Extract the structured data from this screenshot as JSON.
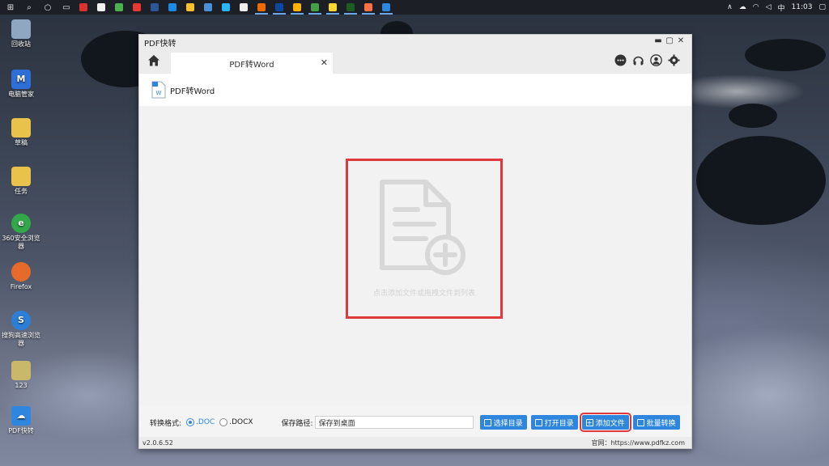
{
  "taskbar": {
    "clock": "11:03",
    "ime": "中",
    "tray_expand": "∧"
  },
  "desktop_icons": [
    {
      "label": "回收站",
      "color": "#8fa7c0"
    },
    {
      "label": "电脑管家",
      "color": "#2d6fd6"
    },
    {
      "label": "草稿",
      "color": "#e8c24a"
    },
    {
      "label": "任务",
      "color": "#e8c24a"
    },
    {
      "label": "360安全浏览器",
      "color": "#33a84a"
    },
    {
      "label": "Firefox",
      "color": "#e86a2a"
    },
    {
      "label": "搜狗高速浏览器",
      "color": "#2b7fd9"
    },
    {
      "label": "123",
      "color": "#c9b76a"
    },
    {
      "label": "PDF快转",
      "color": "#2f86de"
    }
  ],
  "window": {
    "title": "PDF快转",
    "minimize": "▬",
    "maximize": "▢",
    "close": "✕"
  },
  "tab": {
    "label": "PDF转Word",
    "close": "✕"
  },
  "subheader": {
    "label": "PDF转Word"
  },
  "dropzone": {
    "hint": "点击添加文件或拖拽文件到列表"
  },
  "bottombar": {
    "format_label": "转换格式:",
    "options": [
      ".DOC",
      ".DOCX"
    ],
    "selected_option": ".DOC",
    "path_label": "保存路径:",
    "path_value": "保存到桌面",
    "btn_choose_dir": "选择目录",
    "btn_open_dir": "打开目录",
    "btn_add_file": "添加文件",
    "btn_batch": "批量转换"
  },
  "statusbar": {
    "version": "v2.0.6.52",
    "site": "官网：https://www.pdfkz.com"
  },
  "colors": {
    "accent": "#2f86de",
    "highlight": "#e0383c"
  }
}
